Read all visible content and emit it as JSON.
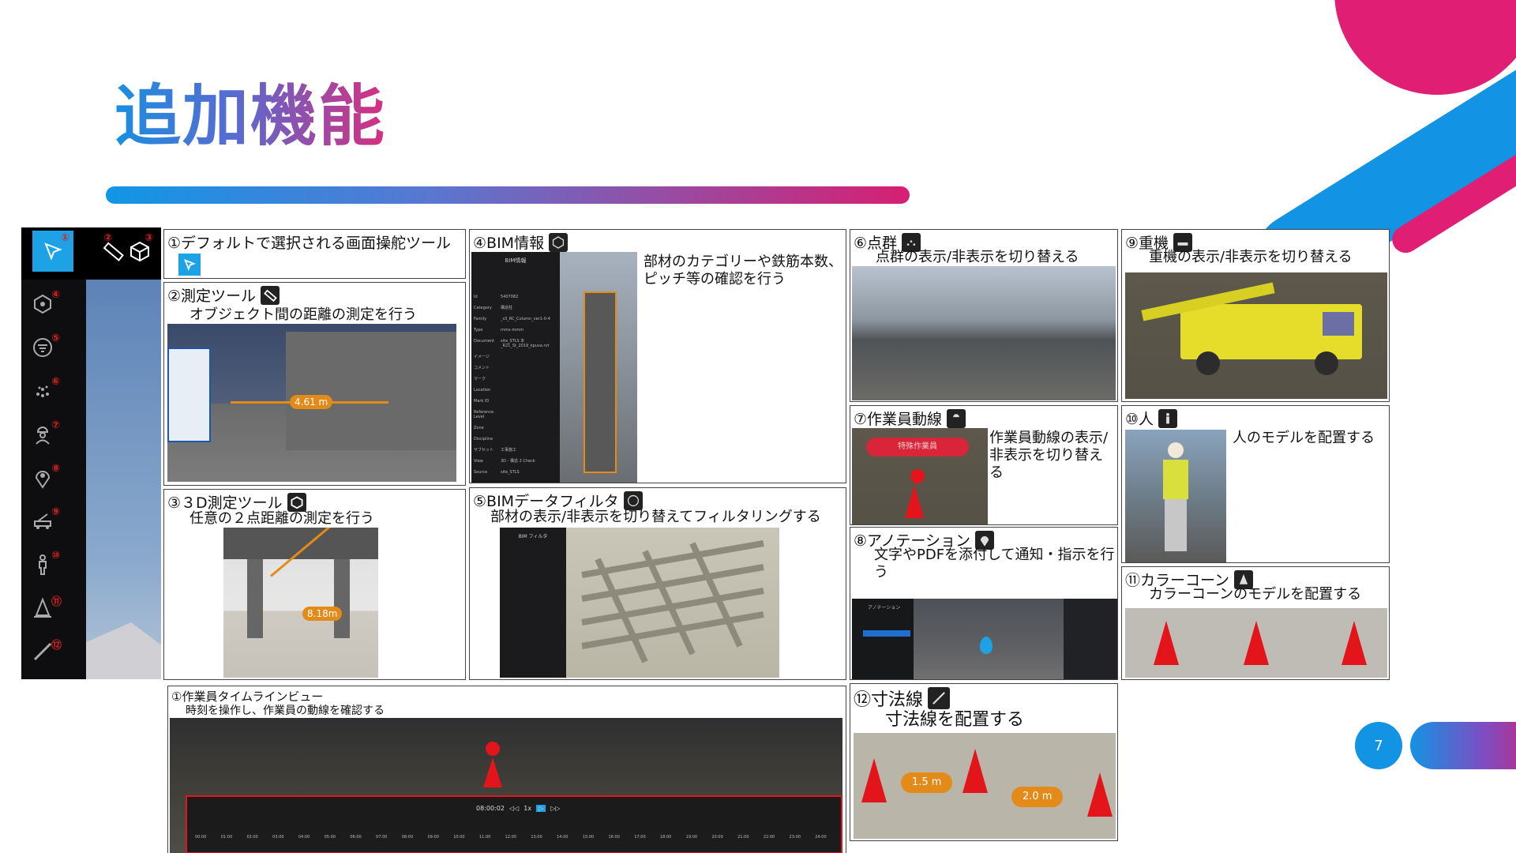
{
  "title": "追加機能",
  "page_number": "7",
  "colors": {
    "accent_blue": "#1393E3",
    "accent_pink": "#E01E74",
    "cone_red": "#E4141B",
    "label_orange": "#E48A18"
  },
  "toolbar": {
    "numbers": [
      "①",
      "②",
      "③",
      "④",
      "⑤",
      "⑥",
      "⑦",
      "⑧",
      "⑨",
      "⑩",
      "⑪",
      "⑫"
    ],
    "icons": [
      "select-arrow-icon",
      "ruler-icon",
      "cube-icon",
      "bim-info-icon",
      "filter-icon",
      "point-cloud-icon",
      "worker-icon",
      "pin-icon",
      "crane-icon",
      "person-icon",
      "cone-icon",
      "dimension-line-icon"
    ]
  },
  "panels": {
    "p1": {
      "title": "①デフォルトで選択される画面操舵ツール"
    },
    "p2": {
      "title": "②測定ツール",
      "desc": "オブジェクト間の距離の測定を行う",
      "label": "4.61 m"
    },
    "p3": {
      "title": "③３D測定ツール",
      "desc": "任意の２点距離の測定を行う",
      "label": "8.18m"
    },
    "p4": {
      "title": "④BIM情報",
      "desc": "部材のカテゴリーや鉄筋本数、ピッチ等の確認を行う",
      "ui_header": "BIM情報",
      "rows": [
        {
          "k": "Id",
          "v": "5407082"
        },
        {
          "k": "Category",
          "v": "構造柱"
        },
        {
          "k": "Family",
          "v": "_s3_RC_Column_ver1-0-4"
        },
        {
          "k": "Type",
          "v": "mmx-mmm"
        },
        {
          "k": "Document",
          "v": "site_STLS 本_R21_St_2019_kpuva.rvt"
        },
        {
          "k": "イメージ",
          "v": ""
        },
        {
          "k": "コメント",
          "v": ""
        },
        {
          "k": "マーク",
          "v": ""
        },
        {
          "k": "Location",
          "v": ""
        },
        {
          "k": "Mark ID",
          "v": ""
        },
        {
          "k": "Reference Level",
          "v": ""
        },
        {
          "k": "Zone",
          "v": ""
        },
        {
          "k": "Discipline",
          "v": ""
        },
        {
          "k": "サブセット",
          "v": "工事施工"
        },
        {
          "k": "View",
          "v": "3D - 構造 2 Check"
        },
        {
          "k": "Source",
          "v": "site_STLS"
        }
      ]
    },
    "p5": {
      "title": "⑤BIMデータフィルタ",
      "desc": "部材の表示/非表示を切り替えてフィルタリングする",
      "ui_header": "BIM フィルタ"
    },
    "p6": {
      "title": "⑥点群",
      "desc": "点群の表示/非表示を切り替える"
    },
    "p7": {
      "title": "⑦作業員動線",
      "desc": "作業員動線の表示/非表示を切り替える",
      "label": "特殊作業員"
    },
    "p8": {
      "title": "⑧アノテーション",
      "desc": "文字やPDFを添付して通知・指示を行う",
      "ui_header": "アノテーション"
    },
    "p9": {
      "title": "⑨重機",
      "desc": "重機の表示/非表示を切り替える"
    },
    "p10": {
      "title": "⑩人",
      "desc": "人のモデルを配置する"
    },
    "p11": {
      "title": "⑪カラーコーン",
      "desc": "カラーコーンのモデルを配置する"
    },
    "p12": {
      "title": "⑫寸法線",
      "desc": "寸法線を配置する",
      "label1": "1.5 m",
      "label2": "2.0 m"
    },
    "timeline": {
      "title": "①作業員タイムラインビュー",
      "desc": "時刻を操作し、作業員の動線を確認する",
      "time": "08:00:02",
      "speed": "1x",
      "ticks": [
        "00:00",
        "01:00",
        "02:00",
        "03:00",
        "04:00",
        "05:00",
        "06:00",
        "07:00",
        "08:00",
        "09:00",
        "10:00",
        "11:00",
        "12:00",
        "13:00",
        "14:00",
        "15:00",
        "16:00",
        "17:00",
        "18:00",
        "19:00",
        "20:00",
        "21:00",
        "22:00",
        "23:00",
        "24:00"
      ]
    }
  }
}
